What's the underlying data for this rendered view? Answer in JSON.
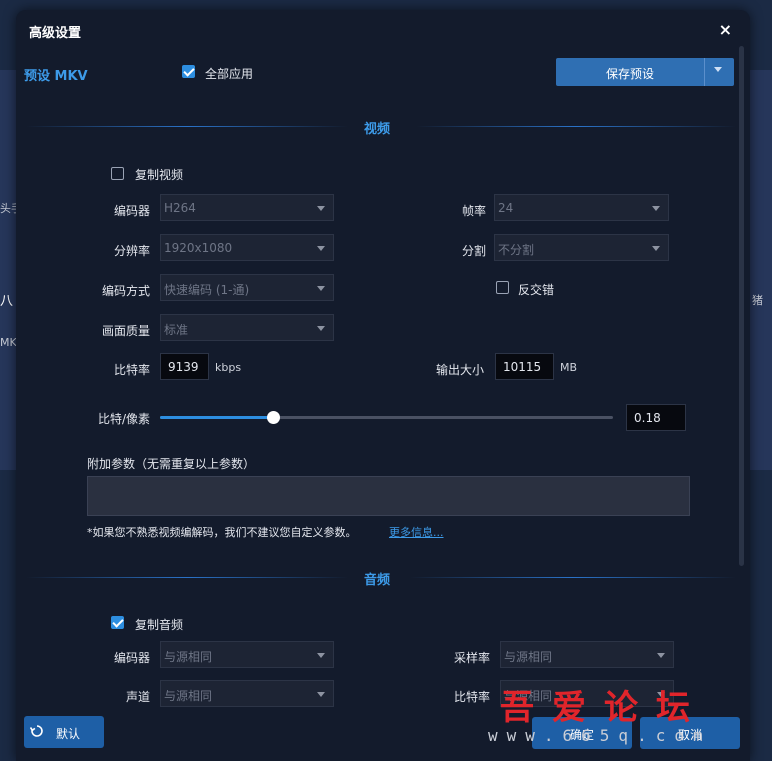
{
  "background": {
    "left_text_1": "头手",
    "left_text_2": "八",
    "left_text_3": "MK",
    "right_text": "猪"
  },
  "dialog": {
    "title": "高级设置",
    "close_label": "×"
  },
  "preset": {
    "label": "预设 MKV",
    "apply_all_label": "全部应用",
    "apply_all_checked": true,
    "save_preset_label": "保存预设"
  },
  "video": {
    "section_title": "视频",
    "copy_video_label": "复制视频",
    "copy_video_checked": false,
    "encoder_label": "编码器",
    "encoder_value": "H264",
    "framerate_label": "帧率",
    "framerate_value": "24",
    "resolution_label": "分辨率",
    "resolution_value": "1920x1080",
    "split_label": "分割",
    "split_value": "不分割",
    "encode_mode_label": "编码方式",
    "encode_mode_value": "快速编码 (1-通)",
    "deinterlace_label": "反交错",
    "deinterlace_checked": false,
    "quality_label": "画面质量",
    "quality_value": "标准",
    "bitrate_label": "比特率",
    "bitrate_value": "9139",
    "bitrate_unit": "kbps",
    "output_size_label": "输出大小",
    "output_size_value": "10115",
    "output_size_unit": "MB",
    "bits_per_pixel_label": "比特/像素",
    "bits_per_pixel_value": "0.18",
    "bits_per_pixel_fraction": 0.25,
    "extra_params_label": "附加参数（无需重复以上参数）",
    "extra_params_value": "",
    "note": "*如果您不熟悉视频编解码，我们不建议您自定义参数。",
    "more_info_link": "更多信息..."
  },
  "audio": {
    "section_title": "音频",
    "copy_audio_label": "复制音频",
    "copy_audio_checked": true,
    "encoder_label": "编码器",
    "encoder_value": "与源相同",
    "samplerate_label": "采样率",
    "samplerate_value": "与源相同",
    "channel_label": "声道",
    "channel_value": "与源相同",
    "bitrate_label": "比特率",
    "bitrate_value": "与源相同"
  },
  "footer": {
    "default_label": "默认",
    "ok_label": "确定",
    "cancel_label": "取消"
  },
  "watermark": {
    "chinese": "吾爱论坛",
    "url": "www.665q.com"
  },
  "colors": {
    "accent": "#3d9be9",
    "button": "#1e5fa6",
    "dialog_bg": "#131b2c",
    "watermark_red": "#e0252b"
  }
}
